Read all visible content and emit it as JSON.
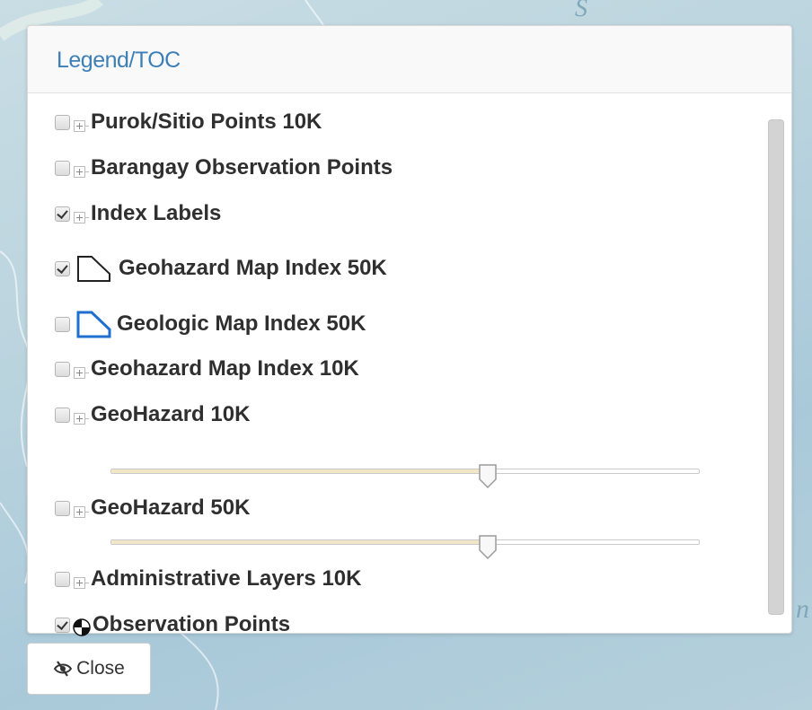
{
  "panel": {
    "title": "Legend/TOC"
  },
  "layers": [
    {
      "label": "Purok/Sitio Points 10K",
      "checked": false,
      "expandable": true
    },
    {
      "label": "Barangay Observation Points",
      "checked": false,
      "expandable": true
    },
    {
      "label": "Index Labels",
      "checked": true,
      "expandable": true
    },
    {
      "label": "Geohazard Map Index 50K",
      "checked": true,
      "expandable": false,
      "symbol": "polygon-outline-black"
    },
    {
      "label": "Geologic Map Index 50K",
      "checked": false,
      "expandable": false,
      "symbol": "polygon-outline-blue"
    },
    {
      "label": "Geohazard Map Index 10K",
      "checked": false,
      "expandable": true
    },
    {
      "label": "GeoHazard 10K",
      "checked": false,
      "expandable": true,
      "opacity": 0.64
    },
    {
      "label": "GeoHazard 50K",
      "checked": false,
      "expandable": true,
      "opacity": 0.64
    },
    {
      "label": "Administrative Layers 10K",
      "checked": false,
      "expandable": true
    },
    {
      "label": "Observation Points",
      "checked": true,
      "expandable": false,
      "symbol": "quartered-circle"
    }
  ],
  "close_button": {
    "label": "Close",
    "icon": "eye-slash-icon"
  },
  "colors": {
    "title": "#3d7fb7",
    "slider_fill": "#f1e6c6",
    "symbol_black": "#222222",
    "symbol_blue": "#1f6fd1"
  }
}
